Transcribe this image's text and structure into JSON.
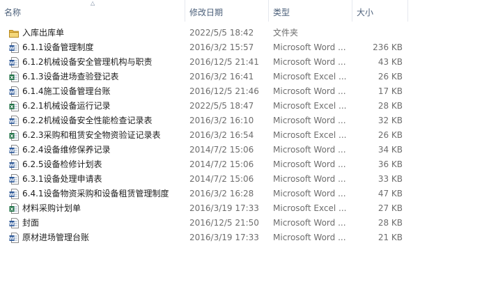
{
  "columns": {
    "name": "名称",
    "date": "修改日期",
    "type": "类型",
    "size": "大小"
  },
  "icon_names": {
    "folder": "folder-icon",
    "word": "word-document-icon",
    "excel": "excel-document-icon"
  },
  "files": [
    {
      "kind": "folder",
      "name": "入库出库单",
      "date": "2022/5/5 18:42",
      "type": "文件夹",
      "size": ""
    },
    {
      "kind": "word",
      "name": "6.1.1设备管理制度",
      "date": "2016/3/2 15:57",
      "type": "Microsoft Word ...",
      "size": "236 KB"
    },
    {
      "kind": "word",
      "name": "6.1.2机械设备安全管理机构与职责",
      "date": "2016/12/5 21:41",
      "type": "Microsoft Word ...",
      "size": "43 KB"
    },
    {
      "kind": "excel",
      "name": "6.1.3设备进场查验登记表",
      "date": "2016/3/2 16:41",
      "type": "Microsoft Excel ...",
      "size": "26 KB"
    },
    {
      "kind": "word",
      "name": "6.1.4施工设备管理台账",
      "date": "2016/12/5 21:46",
      "type": "Microsoft Word ...",
      "size": "17 KB"
    },
    {
      "kind": "excel",
      "name": "6.2.1机械设备运行记录",
      "date": "2022/5/5 18:47",
      "type": "Microsoft Excel ...",
      "size": "28 KB"
    },
    {
      "kind": "word",
      "name": "6.2.2机械设备安全性能检查记录表",
      "date": "2016/3/2 16:10",
      "type": "Microsoft Word ...",
      "size": "32 KB"
    },
    {
      "kind": "excel",
      "name": "6.2.3采购和租赁安全物资验证记录表",
      "date": "2016/3/2 16:54",
      "type": "Microsoft Excel ...",
      "size": "26 KB"
    },
    {
      "kind": "word",
      "name": "6.2.4设备维修保养记录",
      "date": "2014/7/2 15:06",
      "type": "Microsoft Word ...",
      "size": "34 KB"
    },
    {
      "kind": "word",
      "name": "6.2.5设备检修计划表",
      "date": "2014/7/2 15:06",
      "type": "Microsoft Word ...",
      "size": "36 KB"
    },
    {
      "kind": "word",
      "name": "6.3.1设备处理申请表",
      "date": "2014/7/2 15:06",
      "type": "Microsoft Word ...",
      "size": "33 KB"
    },
    {
      "kind": "word",
      "name": "6.4.1设备物资采购和设备租赁管理制度",
      "date": "2016/3/2 16:28",
      "type": "Microsoft Word ...",
      "size": "47 KB"
    },
    {
      "kind": "excel",
      "name": "材料采购计划单",
      "date": "2016/3/19 17:33",
      "type": "Microsoft Excel ...",
      "size": "27 KB"
    },
    {
      "kind": "word",
      "name": "封面",
      "date": "2016/12/5 21:50",
      "type": "Microsoft Word ...",
      "size": "28 KB"
    },
    {
      "kind": "word",
      "name": "原材进场管理台账",
      "date": "2016/3/19 17:33",
      "type": "Microsoft Word ...",
      "size": "21 KB"
    }
  ]
}
